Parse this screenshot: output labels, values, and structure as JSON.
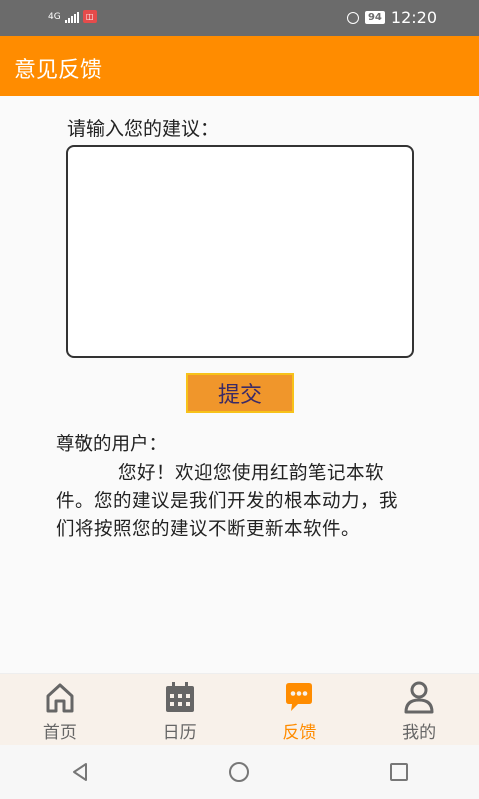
{
  "status_bar": {
    "network": "4G",
    "battery": "94",
    "time": "12:20"
  },
  "app_bar": {
    "title": "意见反馈"
  },
  "feedback": {
    "prompt": "请输入您的建议：",
    "input_value": "",
    "submit_label": "提交"
  },
  "letter": {
    "greeting": "尊敬的用户：",
    "body": "您好！欢迎您使用红韵笔记本软件。您的建议是我们开发的根本动力，我们将按照您的建议不断更新本软件。"
  },
  "tabs": [
    {
      "label": "首页",
      "icon": "home-icon",
      "active": false
    },
    {
      "label": "日历",
      "icon": "calendar-icon",
      "active": false
    },
    {
      "label": "反馈",
      "icon": "chat-bubble-icon",
      "active": true
    },
    {
      "label": "我的",
      "icon": "person-icon",
      "active": false
    }
  ],
  "colors": {
    "accent": "#ff8c00",
    "inactive": "#666666",
    "submit_button": "#f0962b"
  }
}
